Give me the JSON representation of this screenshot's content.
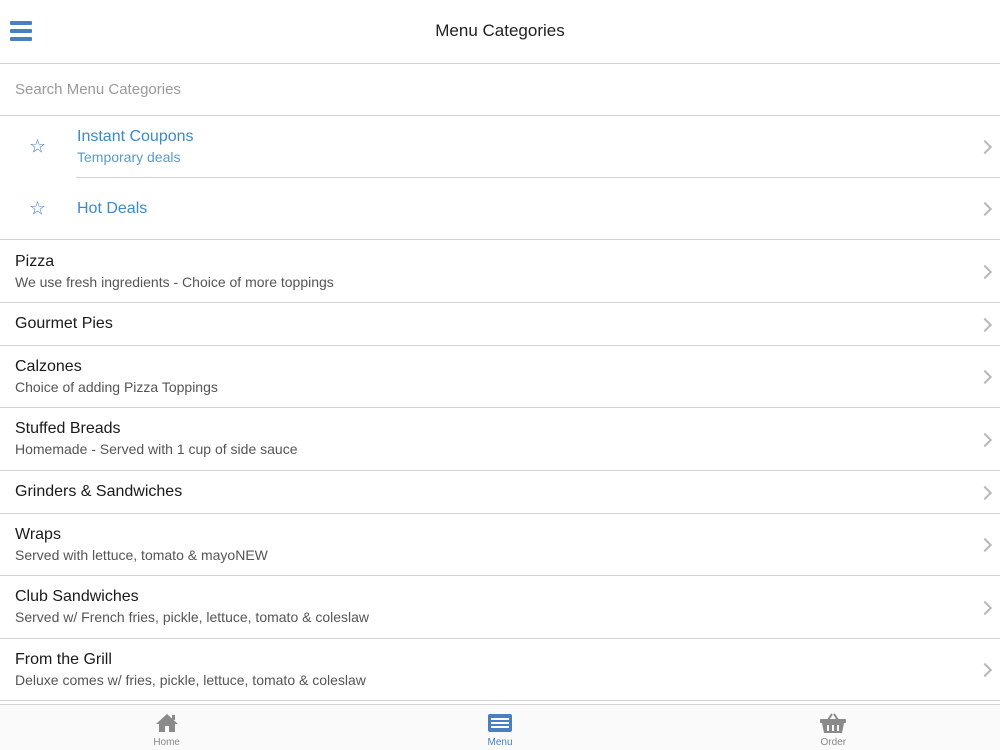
{
  "header": {
    "title": "Menu Categories",
    "menu_icon": "hamburger-icon"
  },
  "search": {
    "placeholder": "Search Menu Categories",
    "value": ""
  },
  "featured": [
    {
      "title": "Instant Coupons",
      "subtitle": "Temporary deals",
      "icon": "star-icon"
    },
    {
      "title": "Hot Deals",
      "subtitle": "",
      "icon": "star-icon"
    }
  ],
  "categories": [
    {
      "title": "Pizza",
      "subtitle": "We use fresh ingredients - Choice of more toppings"
    },
    {
      "title": "Gourmet Pies",
      "subtitle": ""
    },
    {
      "title": "Calzones",
      "subtitle": "Choice of adding Pizza Toppings"
    },
    {
      "title": "Stuffed Breads",
      "subtitle": "Homemade - Served with 1 cup of side sauce"
    },
    {
      "title": "Grinders & Sandwiches",
      "subtitle": ""
    },
    {
      "title": "Wraps",
      "subtitle": "Served with lettuce, tomato & mayoNEW"
    },
    {
      "title": "Club Sandwiches",
      "subtitle": "Served w/ French fries, pickle, lettuce, tomato & coleslaw"
    },
    {
      "title": "From the Grill",
      "subtitle": "Deluxe comes w/ fries, pickle, lettuce, tomato & coleslaw"
    }
  ],
  "tabbar": {
    "home": {
      "label": "Home",
      "icon": "home-icon"
    },
    "menu": {
      "label": "Menu",
      "icon": "menu-list-icon",
      "active": true
    },
    "order": {
      "label": "Order",
      "icon": "basket-icon"
    }
  },
  "colors": {
    "accent": "#4a7fc0",
    "link": "#3d8ac7",
    "separator": "#d4d4d4"
  }
}
